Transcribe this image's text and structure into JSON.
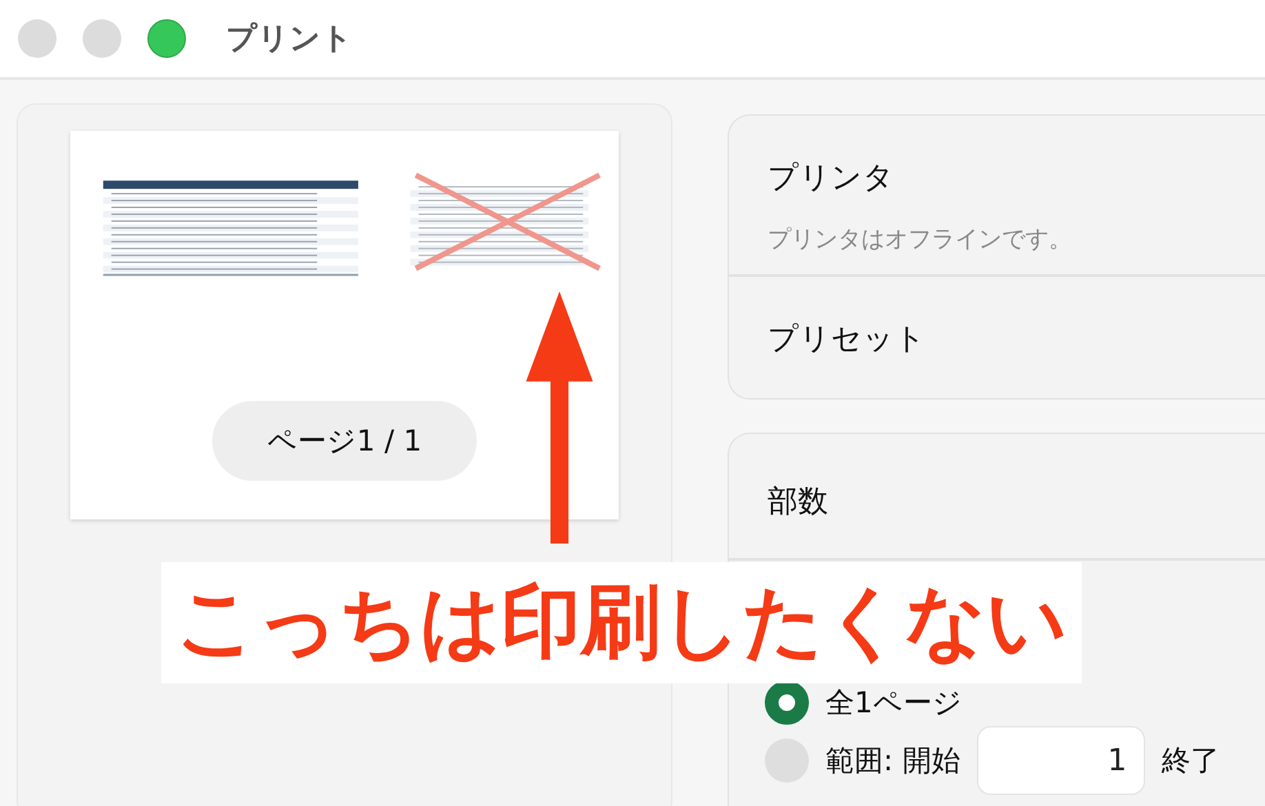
{
  "window": {
    "title": "プリント"
  },
  "preview": {
    "page_label": "ページ1 / 1"
  },
  "printer": {
    "label": "プリンタ",
    "status": "プリンタはオフラインです。"
  },
  "preset": {
    "label": "プリセット"
  },
  "copies": {
    "label": "部数"
  },
  "pages": [
    {
      "kind": "all",
      "label": "全1ページ",
      "selected": true
    },
    {
      "kind": "range",
      "label": "範囲: 開始",
      "from": "1",
      "to_label": "終了",
      "selected": false
    }
  ],
  "annotation": {
    "text": "こっちは印刷したくない"
  }
}
